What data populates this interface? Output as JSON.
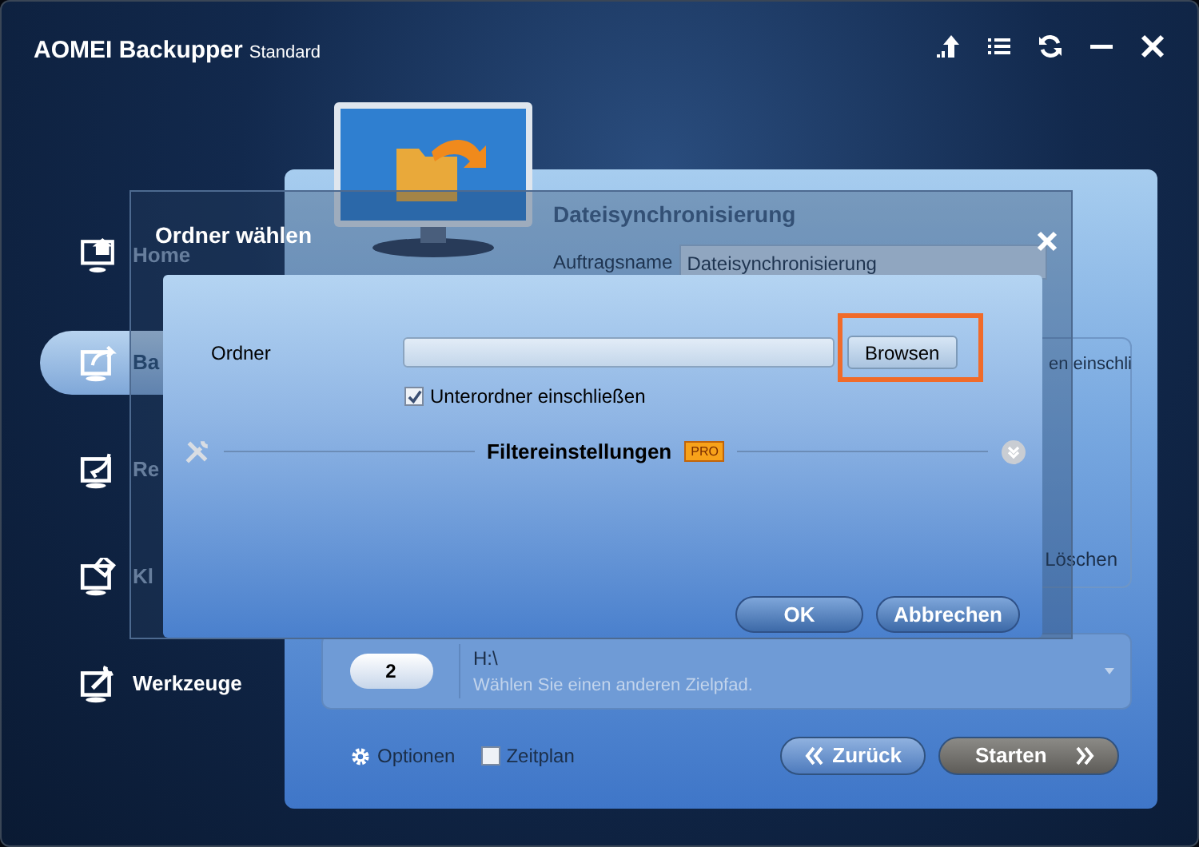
{
  "app": {
    "title": "AOMEI Backupper",
    "edition": "Standard"
  },
  "sidebar": {
    "items": [
      {
        "label": "Home",
        "selected": false
      },
      {
        "label": "Ba",
        "selected": true
      },
      {
        "label": "Re",
        "selected": false
      },
      {
        "label": "Kl",
        "selected": false
      },
      {
        "label": "Werkzeuge",
        "selected": false
      }
    ]
  },
  "panel": {
    "title": "Dateisynchronisierung",
    "job_name_label": "Auftragsname",
    "job_name_value": "Dateisynchronisierung",
    "source_option": "en einschli",
    "source_action": "Löschen",
    "target": {
      "step": "2",
      "path": "H:\\",
      "hint": "Wählen Sie einen anderen Zielpfad."
    },
    "options_label": "Optionen",
    "schedule": {
      "label": "Zeitplan",
      "checked": false
    },
    "back_button": "Zurück",
    "start_button": "Starten"
  },
  "dialog": {
    "title": "Ordner wählen",
    "folder_label": "Ordner",
    "browse_button": {
      "label": "Browsen",
      "highlighted": true
    },
    "include_subfolders": {
      "label": "Unterordner einschließen",
      "checked": true
    },
    "filter": {
      "label": "Filtereinstellungen",
      "badge": "PRO",
      "expanded": false
    },
    "buttons": [
      "OK",
      "Abbrechen"
    ]
  }
}
